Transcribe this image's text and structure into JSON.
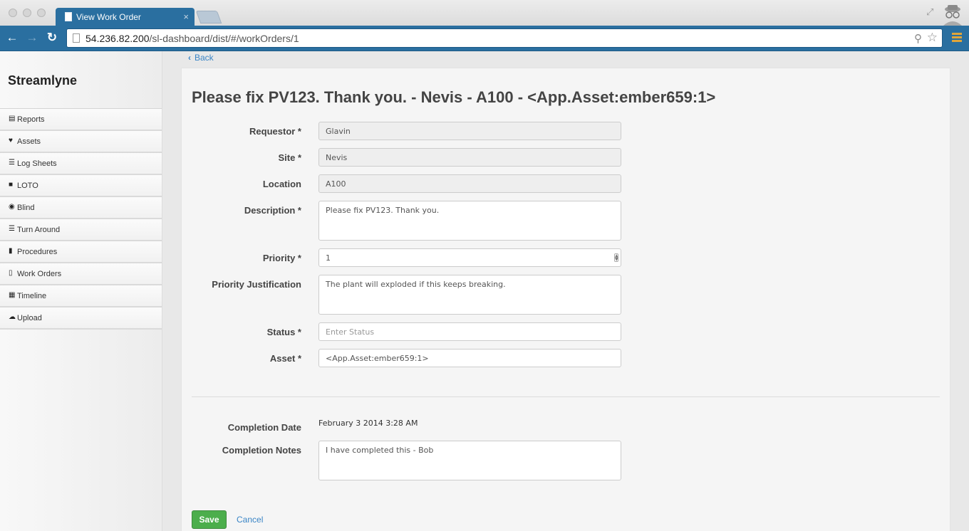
{
  "browser": {
    "tab_title": "View Work Order",
    "tab_close": "×",
    "url_host": "54.236.82.200",
    "url_path": "/sl-dashboard/dist/#/workOrders/1"
  },
  "sidebar": {
    "brand": "Streamlyne",
    "items": [
      {
        "label": "Reports",
        "icon": "report-icon"
      },
      {
        "label": "Assets",
        "icon": "heart-icon"
      },
      {
        "label": "Log Sheets",
        "icon": "list-icon"
      },
      {
        "label": "LOTO",
        "icon": "lock-icon"
      },
      {
        "label": "Blind",
        "icon": "eye-slash-icon"
      },
      {
        "label": "Turn Around",
        "icon": "tasks-icon"
      },
      {
        "label": "Procedures",
        "icon": "book-icon"
      },
      {
        "label": "Work Orders",
        "icon": "file-icon"
      },
      {
        "label": "Timeline",
        "icon": "calendar-icon"
      },
      {
        "label": "Upload",
        "icon": "cloud-upload-icon"
      }
    ]
  },
  "main": {
    "back_label": "Back",
    "title": "Please fix PV123. Thank you. - Nevis - A100 - <App.Asset:ember659:1>",
    "fields": {
      "requestor": {
        "label": "Requestor *",
        "value": "Glavin"
      },
      "site": {
        "label": "Site *",
        "value": "Nevis"
      },
      "location": {
        "label": "Location",
        "value": "A100"
      },
      "description": {
        "label": "Description *",
        "value": "Please fix PV123. Thank you."
      },
      "priority": {
        "label": "Priority *",
        "value": "1"
      },
      "priority_justification": {
        "label": "Priority Justification",
        "value": "The plant will exploded if this keeps breaking."
      },
      "status": {
        "label": "Status *",
        "value": "",
        "placeholder": "Enter Status"
      },
      "asset": {
        "label": "Asset *",
        "value": "<App.Asset:ember659:1>"
      }
    },
    "completion": {
      "date_label": "Completion Date",
      "date_value": "February 3 2014 3:28 AM",
      "notes_label": "Completion Notes",
      "notes_value": "I have completed this - Bob"
    },
    "actions": {
      "save_label": "Save",
      "cancel_label": "Cancel"
    }
  },
  "colors": {
    "chrome_blue": "#2a6fa0",
    "link": "#3a85c6",
    "save_green": "#4cae4c"
  }
}
